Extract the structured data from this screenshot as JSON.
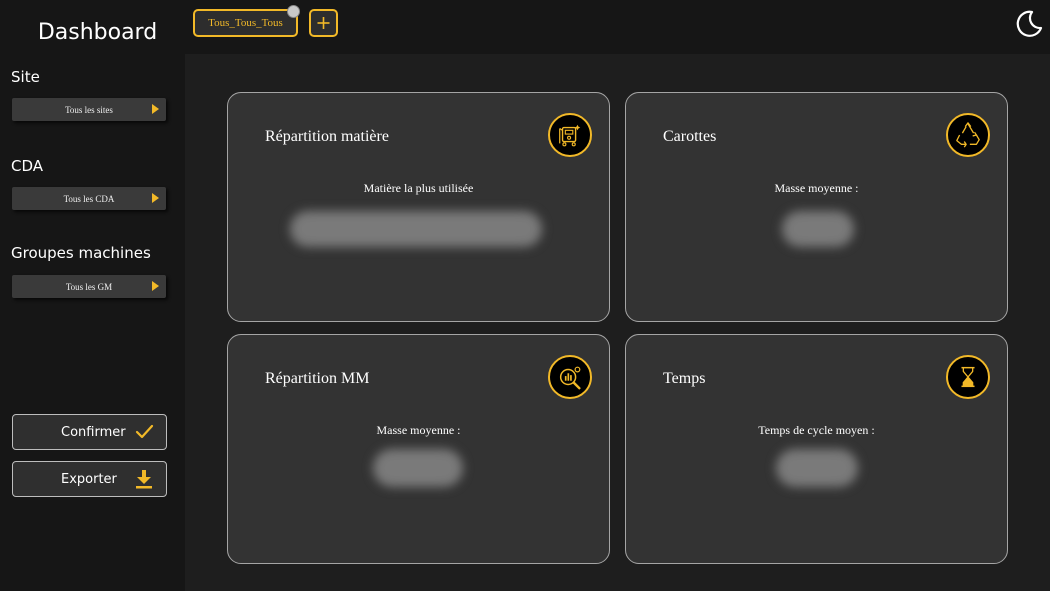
{
  "sidebar": {
    "title": "Dashboard",
    "site": {
      "label": "Site",
      "value": "Tous les sites"
    },
    "cda": {
      "label": "CDA",
      "value": "Tous les CDA"
    },
    "gm": {
      "label": "Groupes machines",
      "value": "Tous les GM"
    },
    "confirm_label": "Confirmer",
    "export_label": "Exporter"
  },
  "topbar": {
    "tab_label": "Tous_Tous_Tous",
    "add_icon": "plus-icon",
    "theme_icon": "moon-icon"
  },
  "cards": [
    {
      "title": "Répartition matière",
      "label": "Matière la plus utilisée",
      "icon": "material-icon"
    },
    {
      "title": "Carottes",
      "label": "Masse moyenne :",
      "icon": "recycle-icon"
    },
    {
      "title": "Répartition MM",
      "label": "Masse moyenne :",
      "icon": "analytics-icon"
    },
    {
      "title": "Temps",
      "label": "Temps de cycle moyen :",
      "icon": "hourglass-icon"
    }
  ],
  "colors": {
    "accent": "#f2b928",
    "background": "#1e1e1e",
    "sidebar": "#161616",
    "card": "#333333"
  }
}
